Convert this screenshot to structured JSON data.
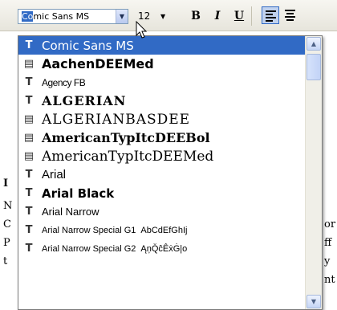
{
  "toolbar": {
    "font_value_selected": "Co",
    "font_value_rest": "mic Sans MS",
    "combo_arrow": "▼",
    "font_size": "12",
    "size_arrow": "▼",
    "bold_label": "B",
    "italic_label": "I",
    "underline_label": "U"
  },
  "doc_fragments": {
    "f1": "I",
    "f2": "N",
    "f3": "C",
    "f4": "P",
    "f5": "t",
    "r1": "or",
    "r2": "ff",
    "r3": "y",
    "r4": "nt"
  },
  "font_list": {
    "items": [
      {
        "name": "Comic Sans MS",
        "type_icon": "T",
        "selected": true
      },
      {
        "name": "AachenDEEMed",
        "type_icon": "▤",
        "selected": false
      },
      {
        "name": "Agency FB",
        "type_icon": "T",
        "selected": false
      },
      {
        "name": "ALGERIAN",
        "type_icon": "T",
        "selected": false
      },
      {
        "name": "ALGERIANBASDEE",
        "type_icon": "▤",
        "selected": false
      },
      {
        "name": "AmericanTypItcDEEBol",
        "type_icon": "▤",
        "selected": false
      },
      {
        "name": "AmericanTypItcDEEMed",
        "type_icon": "▤",
        "selected": false
      },
      {
        "name": "Arial",
        "type_icon": "T",
        "selected": false
      },
      {
        "name": "Arial Black",
        "type_icon": "T",
        "selected": false
      },
      {
        "name": "Arial Narrow",
        "type_icon": "T",
        "selected": false
      },
      {
        "name": "Arial Narrow Special G1",
        "type_icon": "T",
        "selected": false,
        "preview": "AbCdEfGhIj"
      },
      {
        "name": "Arial Narrow Special G2",
        "type_icon": "T",
        "selected": false,
        "preview": "ĄņQ̆ĉÊẋĠ|o"
      }
    ],
    "scroll_up": "▲",
    "scroll_down": "▼"
  }
}
